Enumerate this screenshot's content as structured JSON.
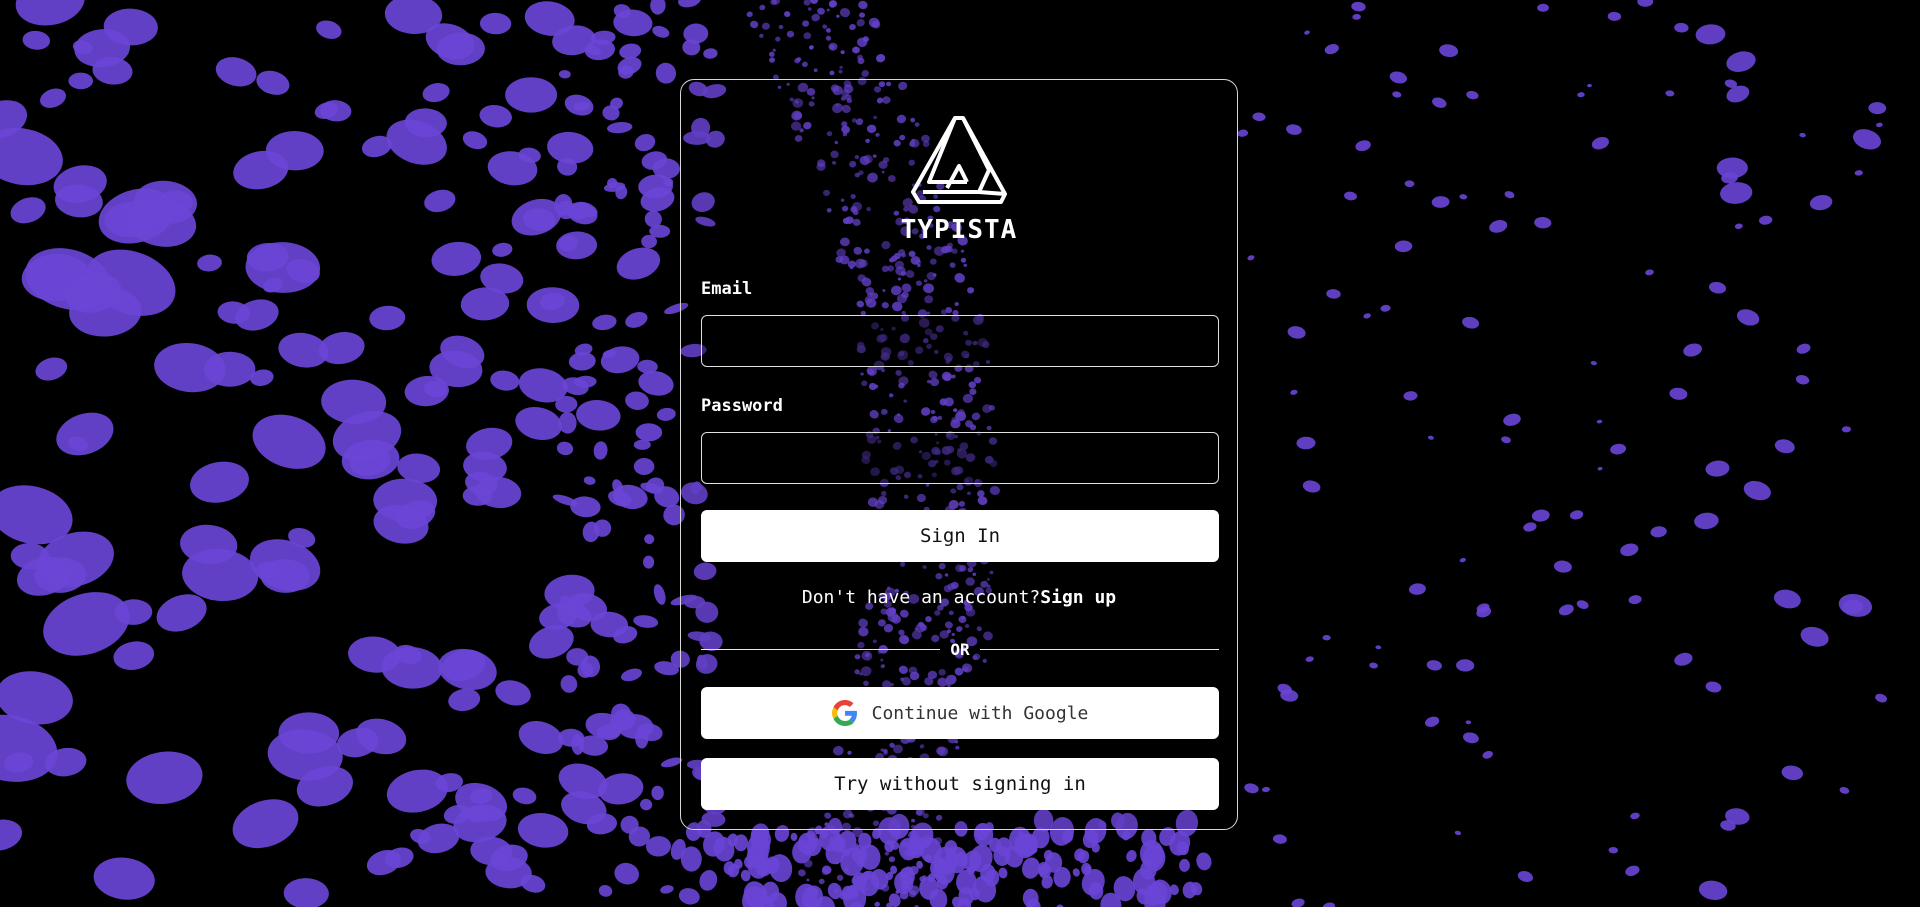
{
  "colors": {
    "background": "#000000",
    "particle": "#6a45d6",
    "card_border": "#d8d8d8",
    "button_bg": "#ffffff"
  },
  "brand": {
    "logo_icon": "impossible-triangle-logo-icon",
    "name": "TYPISTA"
  },
  "form": {
    "email_label": "Email",
    "email_value": "",
    "email_placeholder": "",
    "password_label": "Password",
    "password_value": "",
    "password_placeholder": "",
    "sign_in_label": "Sign In"
  },
  "signup": {
    "prompt": "Don't have an account?",
    "link_label": "Sign up"
  },
  "divider": {
    "label": "OR"
  },
  "google": {
    "icon": "google-icon",
    "label": "Continue with Google"
  },
  "guest": {
    "label": "Try without signing in"
  }
}
